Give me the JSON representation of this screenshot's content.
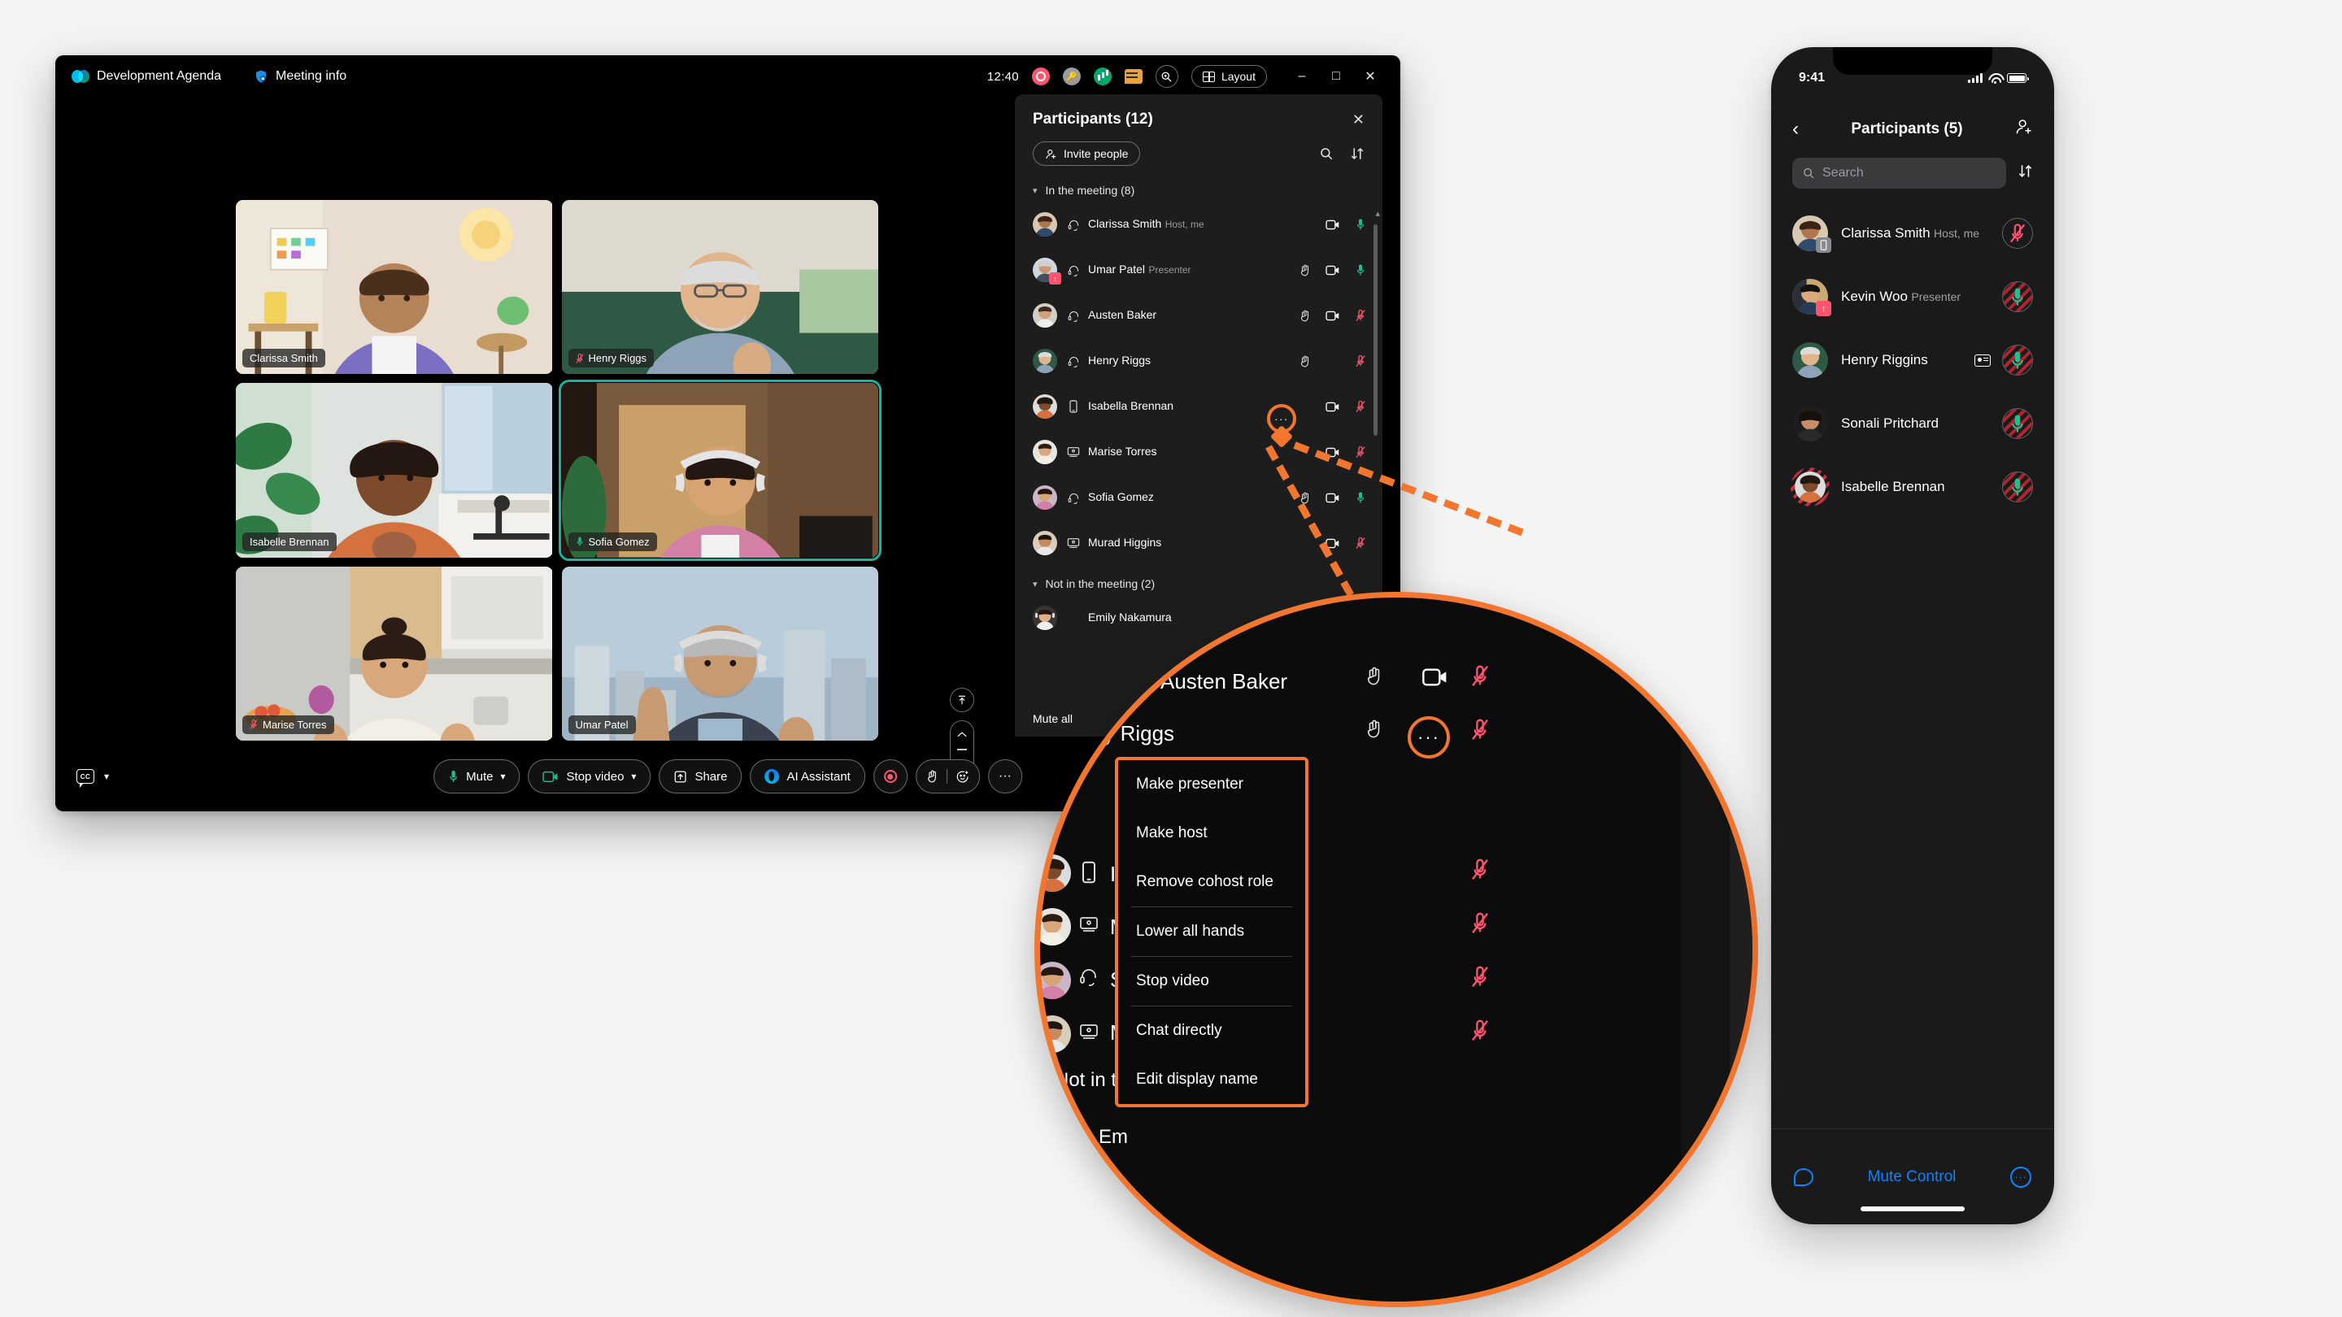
{
  "desktop": {
    "titlebar": {
      "tabs": [
        {
          "label": "Development Agenda",
          "icon": "webex-logo"
        },
        {
          "label": "Meeting info",
          "icon": "shield-lock-icon"
        }
      ],
      "clock": "12:40",
      "status_icons": [
        "recording-badge",
        "key-badge",
        "network-quality-badge",
        "chat-badge"
      ],
      "zoom_label": "",
      "layout_label": "Layout",
      "window_controls": {
        "minimize": "–",
        "maximize": "□",
        "close": "✕"
      }
    },
    "grid": [
      {
        "name": "Clarissa Smith",
        "muted": false,
        "show_mic": false,
        "active": false
      },
      {
        "name": "Henry Riggs",
        "muted": true,
        "show_mic": true,
        "active": false
      },
      {
        "name": "Isabelle Brennan",
        "muted": false,
        "show_mic": false,
        "active": false
      },
      {
        "name": "Sofia Gomez",
        "muted": false,
        "show_mic": true,
        "active": true
      },
      {
        "name": "Marise Torres",
        "muted": true,
        "show_mic": true,
        "active": false
      },
      {
        "name": "Umar Patel",
        "muted": false,
        "show_mic": false,
        "active": false
      }
    ],
    "bottom_bar": {
      "cc_label": "CC",
      "mute_label": "Mute",
      "stop_video_label": "Stop video",
      "share_label": "Share",
      "ai_assistant_label": "AI Assistant",
      "more_label": "···"
    }
  },
  "participants_panel": {
    "title": "Participants (12)",
    "close_label": "✕",
    "invite_label": "Invite people",
    "search_label": "",
    "sort_label": "",
    "section_in": "In the meeting (8)",
    "section_out": "Not in the meeting (2)",
    "mute_all_label": "Mute all",
    "in_meeting": [
      {
        "name": "Clarissa Smith",
        "sub": "Host, me",
        "device": "headset",
        "hand": false,
        "video": true,
        "mic": "on",
        "badge": null
      },
      {
        "name": "Umar Patel",
        "sub": "Presenter",
        "device": "headset",
        "hand": true,
        "video": true,
        "mic": "on",
        "badge": "presenter"
      },
      {
        "name": "Austen Baker",
        "sub": "",
        "device": "headset",
        "hand": true,
        "video": true,
        "mic": "muted",
        "badge": null
      },
      {
        "name": "Henry Riggs",
        "sub": "",
        "device": "headset",
        "hand": true,
        "video": "menu",
        "mic": "muted",
        "badge": null
      },
      {
        "name": "Isabella Brennan",
        "sub": "",
        "device": "phone",
        "hand": false,
        "video": true,
        "mic": "muted",
        "badge": null
      },
      {
        "name": "Marise Torres",
        "sub": "",
        "device": "desktop",
        "hand": false,
        "video": true,
        "mic": "muted",
        "badge": null
      },
      {
        "name": "Sofia Gomez",
        "sub": "",
        "device": "headset",
        "hand": true,
        "video": true,
        "mic": "on",
        "badge": null
      },
      {
        "name": "Murad Higgins",
        "sub": "",
        "device": "desktop",
        "hand": false,
        "video": true,
        "mic": "muted",
        "badge": null
      }
    ],
    "not_in_meeting": [
      {
        "name": "Emily Nakamura",
        "sub": "",
        "device": "",
        "hand": false,
        "video": false,
        "mic": "",
        "badge": null
      }
    ]
  },
  "magnifier": {
    "row_top_name": "Austen Baker",
    "row_focus_name": "Henry Riggs",
    "row_partials": [
      "Isa",
      "Ma",
      "So",
      "Mu"
    ],
    "section_out_partial": "Not in the",
    "name_partial": "Em",
    "dots_label": "···",
    "menu_items": [
      {
        "label": "Make presenter",
        "separator_after": false
      },
      {
        "label": "Make host",
        "separator_after": false
      },
      {
        "label": "Remove cohost role",
        "separator_after": true
      },
      {
        "label": "Lower all hands",
        "separator_after": true
      },
      {
        "label": "Stop video",
        "separator_after": true
      },
      {
        "label": "Chat directly",
        "separator_after": false
      },
      {
        "label": "Edit display name",
        "separator_after": false
      }
    ]
  },
  "phone": {
    "status": {
      "time": "9:41"
    },
    "nav": {
      "back": "‹",
      "title": "Participants (5)",
      "add_person": "add-person-icon"
    },
    "search_placeholder": "Search",
    "participants": [
      {
        "name": "Clarissa Smith",
        "sub": "Host, me",
        "badge": "device",
        "card": false,
        "mic": "muted"
      },
      {
        "name": "Kevin Woo",
        "sub": "Presenter",
        "badge": "presenter",
        "card": false,
        "mic": "on-hatched"
      },
      {
        "name": "Henry Riggins",
        "sub": "",
        "badge": null,
        "card": true,
        "mic": "on-hatched"
      },
      {
        "name": "Sonali Pritchard",
        "sub": "",
        "badge": null,
        "card": false,
        "mic": "on-hatched"
      },
      {
        "name": "Isabelle Brennan",
        "sub": "",
        "badge": null,
        "card": false,
        "mic": "on-hatched",
        "avatar_hatched": true
      }
    ],
    "bottom": {
      "chat_icon": "chat-bubble-icon",
      "mute_control_label": "Mute Control",
      "more_icon": "more-circle-icon"
    }
  },
  "colors": {
    "accent_orange": "#f2762e",
    "active_teal": "#17b5a0",
    "mic_on_green": "#1fbf8f",
    "mic_muted_red": "#ff5470",
    "ios_blue": "#0a84ff"
  }
}
